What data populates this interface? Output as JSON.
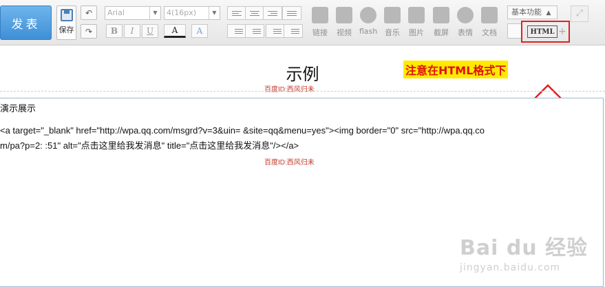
{
  "toolbar": {
    "publish_label": "发表",
    "save_label": "保存",
    "font_family": "Arial",
    "font_size": "4(16px)",
    "format": {
      "bold": "B",
      "italic": "I",
      "underline": "U",
      "font_color": "A",
      "highlight": "A"
    },
    "media": [
      {
        "label": "链接",
        "icon": "link-icon"
      },
      {
        "label": "视频",
        "icon": "video-icon"
      },
      {
        "label": "flash",
        "icon": "flash-icon"
      },
      {
        "label": "音乐",
        "icon": "music-icon"
      },
      {
        "label": "图片",
        "icon": "image-icon"
      },
      {
        "label": "截屏",
        "icon": "screenshot-icon"
      },
      {
        "label": "表情",
        "icon": "emoji-icon"
      },
      {
        "label": "文档",
        "icon": "word-doc-icon"
      }
    ],
    "basic_function_label": "基本功能",
    "html_label": "HTML",
    "plus_label": "+"
  },
  "document": {
    "title": "示例",
    "watermark_top": "百度ID:西风归未",
    "note": "注意在HTML格式下"
  },
  "editor": {
    "line1": "演示展示",
    "line2": "<a target=\"_blank\" href=\"http://wpa.qq.com/msgrd?v=3&uin=                   &site=qq&menu=yes\"><img border=\"0\" src=\"http://wpa.qq.co",
    "line3": "m/pa?p=2:                    :51\" alt=\"点击这里给我发消息\" title=\"点击这里给我发消息\"/></a>",
    "watermark": "百度ID:西风归未"
  },
  "baidu_watermark": {
    "logo": "Bai du 经验",
    "url": "jingyan.baidu.com"
  },
  "colors": {
    "publish_bg": "#4a98dd",
    "highlight_red": "#e02020",
    "note_bg": "#ffea00"
  }
}
